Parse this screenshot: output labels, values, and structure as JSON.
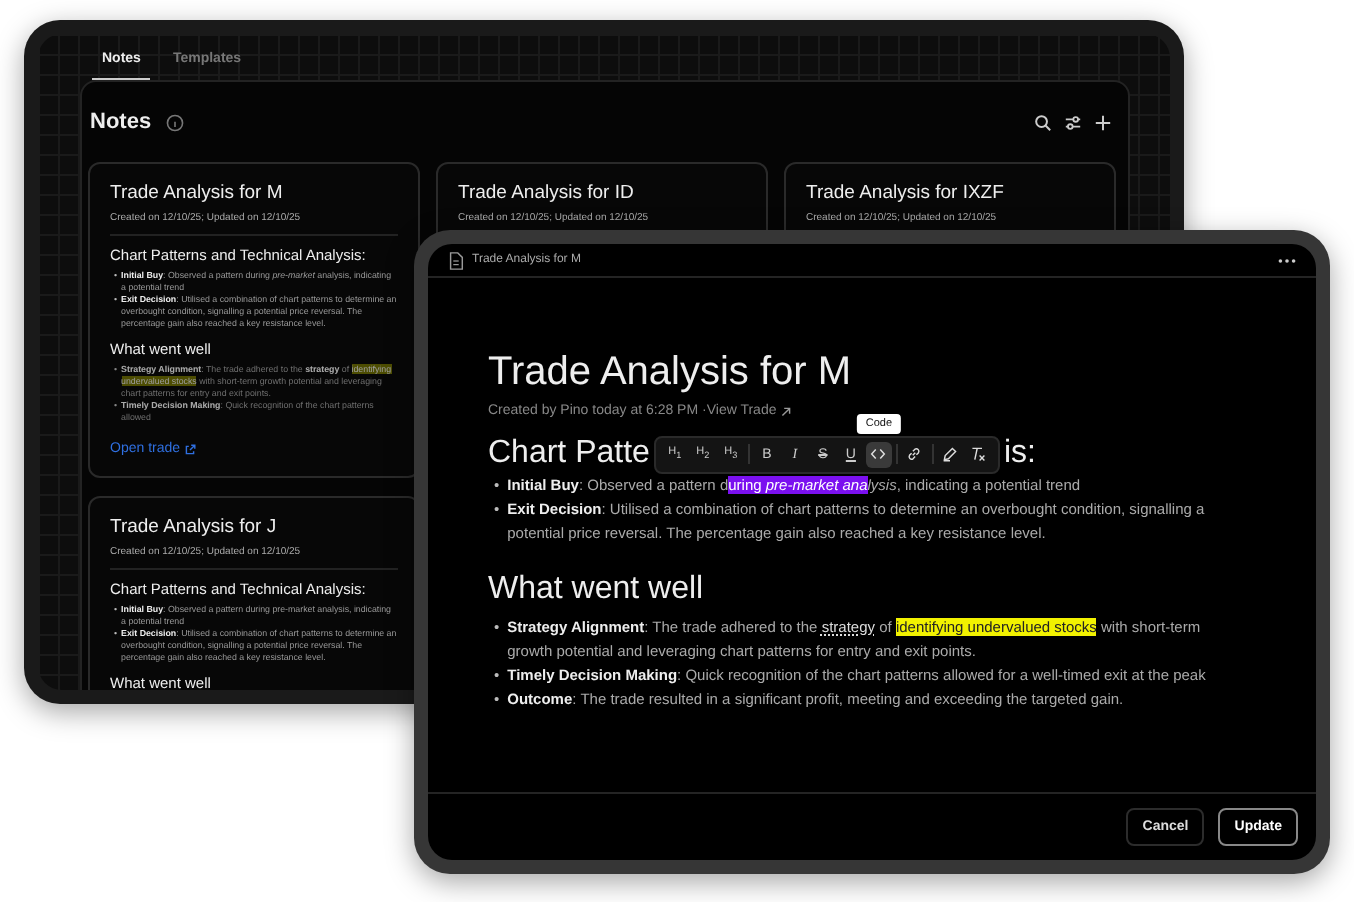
{
  "back_tablet": {
    "tabs": [
      {
        "label": "Notes",
        "selected": true
      },
      {
        "label": "Templates",
        "selected": false
      }
    ],
    "title": "Notes",
    "cards": [
      {
        "title": "Trade Analysis for M",
        "meta": "Created on 12/10/25; Updated on 12/10/25",
        "sections": [
          {
            "heading": "Chart Patterns and Technical Analysis:",
            "bullets": [
              {
                "marker": "•",
                "faded": false,
                "segments": [
                  {
                    "text": "Initial Buy",
                    "kind": "bold"
                  },
                  {
                    "text": ": Observed a pattern during ",
                    "kind": "plain"
                  },
                  {
                    "text": "pre-market",
                    "kind": "italic"
                  },
                  {
                    "text": " analysis, indicating a potential trend",
                    "kind": "plain"
                  }
                ]
              },
              {
                "marker": "•",
                "faded": false,
                "segments": [
                  {
                    "text": "Exit Decision",
                    "kind": "bold"
                  },
                  {
                    "text": ": Utilised a combination of chart patterns to determine an overbought condition, signalling a potential price reversal. The percentage gain also reached a key resistance level.",
                    "kind": "plain"
                  }
                ]
              }
            ]
          },
          {
            "heading": "What went well",
            "bullets": [
              {
                "marker": "•",
                "faded": true,
                "segments": [
                  {
                    "text": "Strategy Alignment",
                    "kind": "bold"
                  },
                  {
                    "text": ": The trade adhered to the ",
                    "kind": "plain"
                  },
                  {
                    "text": "strategy",
                    "kind": "bold"
                  },
                  {
                    "text": " of ",
                    "kind": "plain"
                  },
                  {
                    "text": "identifying undervalued stocks",
                    "kind": "highlight"
                  },
                  {
                    "text": " with short-term growth potential and leveraging chart patterns for entry and exit points.",
                    "kind": "plain"
                  }
                ]
              },
              {
                "marker": "•",
                "faded": true,
                "segments": [
                  {
                    "text": "Timely Decision Making",
                    "kind": "bold"
                  },
                  {
                    "text": ": Quick recognition of the chart patterns allowed",
                    "kind": "plain"
                  }
                ]
              }
            ]
          }
        ],
        "link": "Open trade"
      },
      {
        "title": "Trade Analysis for ID",
        "meta": "Created on 12/10/25; Updated on 12/10/25"
      },
      {
        "title": "Trade Analysis for IXZF",
        "meta": "Created on 12/10/25; Updated on 12/10/25"
      },
      {
        "title": "Trade Analysis for J",
        "meta": "Created on 12/10/25; Updated on 12/10/25",
        "sections": [
          {
            "heading": "Chart Patterns and Technical Analysis:",
            "bullets": [
              {
                "marker": "•",
                "faded": false,
                "segments": [
                  {
                    "text": "Initial Buy",
                    "kind": "bold"
                  },
                  {
                    "text": ": Observed a pattern during pre-market analysis, indicating a potential trend",
                    "kind": "plain"
                  }
                ]
              },
              {
                "marker": "•",
                "faded": false,
                "segments": [
                  {
                    "text": "Exit Decision",
                    "kind": "bold"
                  },
                  {
                    "text": ": Utilised a combination of chart patterns to determine an overbought condition, signalling a potential price reversal. The percentage gain also reached a key resistance level.",
                    "kind": "plain"
                  }
                ]
              }
            ]
          },
          {
            "heading": "What went well"
          }
        ]
      }
    ]
  },
  "editor": {
    "window_title": "Trade Analysis for M",
    "title": "Trade Analysis for M",
    "byline": "Created by Pino today at 6:28 PM · ",
    "byline_link": "View Trade",
    "heading_start": "Chart Patte",
    "heading_end": "is:",
    "toolbar": [
      [
        {
          "kind": "heading",
          "label": "H$_{1}$",
          "selected": false
        },
        {
          "kind": "heading",
          "label": "H$_{2}$",
          "selected": false
        },
        {
          "kind": "heading",
          "label": "H$_{3}$",
          "selected": false
        }
      ],
      [
        {
          "kind": "bold",
          "label": "B",
          "selected": false
        },
        {
          "kind": "italic",
          "label": "I",
          "selected": false
        },
        {
          "kind": "strike",
          "label": "S",
          "selected": false
        },
        {
          "kind": "underline",
          "label": "U",
          "selected": false
        },
        {
          "kind": "code",
          "selected": true
        }
      ],
      [
        {
          "kind": "link",
          "selected": false
        }
      ],
      [
        {
          "kind": "highlight",
          "selected": false
        },
        {
          "kind": "clear",
          "selected": false
        }
      ]
    ],
    "tooltip": "Code",
    "bullets_1": [
      {
        "marker": "•",
        "segments": [
          {
            "text": "Initial Buy",
            "kind": "bold"
          },
          {
            "text": ": Observed a pattern d",
            "kind": "plain"
          },
          {
            "text": "uring ",
            "kind": "selected"
          },
          {
            "text": "pre-market ana",
            "kind": "selected-italic"
          },
          {
            "text": "lysis",
            "kind": "italic"
          },
          {
            "text": ", indicating a potential trend",
            "kind": "plain"
          }
        ]
      },
      {
        "marker": "•",
        "segments": [
          {
            "text": "Exit Decision",
            "kind": "bold"
          },
          {
            "text": ": Utilised a combination of chart patterns to determine an overbought condition, signalling a potential price reversal. The percentage gain also reached a key resistance level.",
            "kind": "plain"
          }
        ]
      }
    ],
    "heading_2": "What went well",
    "bullets_2": [
      {
        "marker": "•",
        "segments": [
          {
            "text": "Strategy Alignment",
            "kind": "bold"
          },
          {
            "text": ": The trade adhered to the ",
            "kind": "plain"
          },
          {
            "text": "strategy",
            "kind": "dotted"
          },
          {
            "text": " of ",
            "kind": "plain"
          },
          {
            "text": "identifying undervalued stocks",
            "kind": "highlight"
          },
          {
            "text": " with short-term growth potential and leveraging chart patterns for entry and exit points.",
            "kind": "plain"
          }
        ]
      },
      {
        "marker": "•",
        "segments": [
          {
            "text": "Timely Decision Making",
            "kind": "bold"
          },
          {
            "text": ": Quick recognition of the chart patterns allowed for a well-timed exit at the peak",
            "kind": "plain"
          }
        ]
      },
      {
        "marker": "•",
        "segments": [
          {
            "text": "Outcome",
            "kind": "bold"
          },
          {
            "text": ": The trade resulted in a significant profit, meeting and exceeding the targeted gain.",
            "kind": "plain"
          }
        ]
      }
    ],
    "buttons": [
      "Cancel",
      "Update"
    ]
  }
}
